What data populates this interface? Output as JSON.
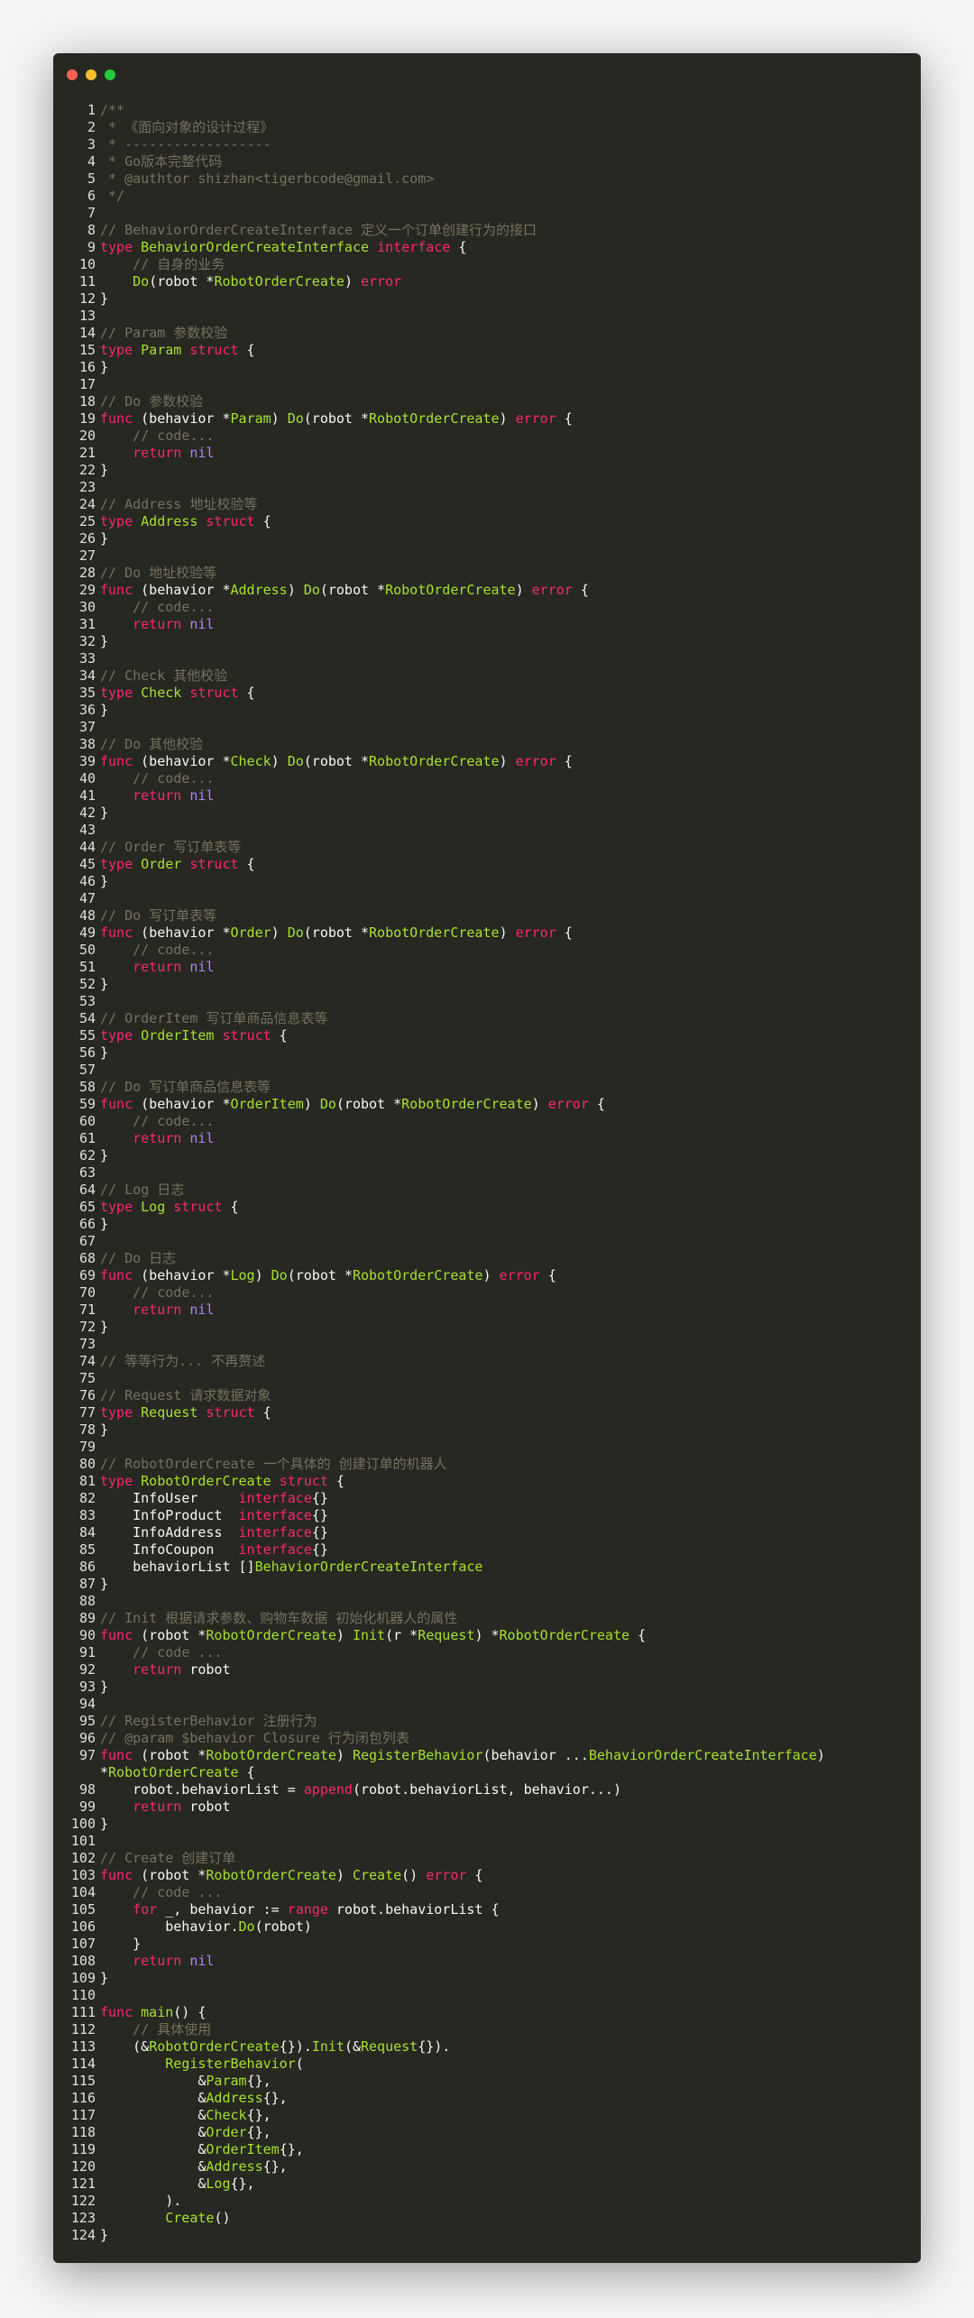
{
  "window": {
    "traffic_lights": [
      "close",
      "minimize",
      "maximize"
    ]
  },
  "lines": [
    [
      [
        "c",
        "/**"
      ]
    ],
    [
      [
        "c",
        " * 《面向对象的设计过程》"
      ]
    ],
    [
      [
        "c",
        " * ------------------"
      ]
    ],
    [
      [
        "c",
        " * Go版本完整代码"
      ]
    ],
    [
      [
        "c",
        " * @authtor shizhan<tigerbcode@gmail.com>"
      ]
    ],
    [
      [
        "c",
        " */"
      ]
    ],
    [],
    [
      [
        "c",
        "// BehaviorOrderCreateInterface 定义一个订单创建行为的接口"
      ]
    ],
    [
      [
        "k",
        "type"
      ],
      [
        "p",
        " "
      ],
      [
        "t",
        "BehaviorOrderCreateInterface"
      ],
      [
        "p",
        " "
      ],
      [
        "k",
        "interface"
      ],
      [
        "p",
        " {"
      ]
    ],
    [
      [
        "p",
        "    "
      ],
      [
        "c",
        "// 自身的业务"
      ]
    ],
    [
      [
        "p",
        "    "
      ],
      [
        "t",
        "Do"
      ],
      [
        "p",
        "(robot *"
      ],
      [
        "t",
        "RobotOrderCreate"
      ],
      [
        "p",
        ") "
      ],
      [
        "k",
        "error"
      ]
    ],
    [
      [
        "p",
        "}"
      ]
    ],
    [],
    [
      [
        "c",
        "// Param 参数校验"
      ]
    ],
    [
      [
        "k",
        "type"
      ],
      [
        "p",
        " "
      ],
      [
        "t",
        "Param"
      ],
      [
        "p",
        " "
      ],
      [
        "k",
        "struct"
      ],
      [
        "p",
        " {"
      ]
    ],
    [
      [
        "p",
        "}"
      ]
    ],
    [],
    [
      [
        "c",
        "// Do 参数校验"
      ]
    ],
    [
      [
        "k",
        "func"
      ],
      [
        "p",
        " (behavior *"
      ],
      [
        "t",
        "Param"
      ],
      [
        "p",
        ") "
      ],
      [
        "t",
        "Do"
      ],
      [
        "p",
        "(robot *"
      ],
      [
        "t",
        "RobotOrderCreate"
      ],
      [
        "p",
        ") "
      ],
      [
        "k",
        "error"
      ],
      [
        "p",
        " {"
      ]
    ],
    [
      [
        "p",
        "    "
      ],
      [
        "c",
        "// code..."
      ]
    ],
    [
      [
        "p",
        "    "
      ],
      [
        "k",
        "return"
      ],
      [
        "p",
        " "
      ],
      [
        "n",
        "nil"
      ]
    ],
    [
      [
        "p",
        "}"
      ]
    ],
    [],
    [
      [
        "c",
        "// Address 地址校验等"
      ]
    ],
    [
      [
        "k",
        "type"
      ],
      [
        "p",
        " "
      ],
      [
        "t",
        "Address"
      ],
      [
        "p",
        " "
      ],
      [
        "k",
        "struct"
      ],
      [
        "p",
        " {"
      ]
    ],
    [
      [
        "p",
        "}"
      ]
    ],
    [],
    [
      [
        "c",
        "// Do 地址校验等"
      ]
    ],
    [
      [
        "k",
        "func"
      ],
      [
        "p",
        " (behavior *"
      ],
      [
        "t",
        "Address"
      ],
      [
        "p",
        ") "
      ],
      [
        "t",
        "Do"
      ],
      [
        "p",
        "(robot *"
      ],
      [
        "t",
        "RobotOrderCreate"
      ],
      [
        "p",
        ") "
      ],
      [
        "k",
        "error"
      ],
      [
        "p",
        " {"
      ]
    ],
    [
      [
        "p",
        "    "
      ],
      [
        "c",
        "// code..."
      ]
    ],
    [
      [
        "p",
        "    "
      ],
      [
        "k",
        "return"
      ],
      [
        "p",
        " "
      ],
      [
        "n",
        "nil"
      ]
    ],
    [
      [
        "p",
        "}"
      ]
    ],
    [],
    [
      [
        "c",
        "// Check 其他校验"
      ]
    ],
    [
      [
        "k",
        "type"
      ],
      [
        "p",
        " "
      ],
      [
        "t",
        "Check"
      ],
      [
        "p",
        " "
      ],
      [
        "k",
        "struct"
      ],
      [
        "p",
        " {"
      ]
    ],
    [
      [
        "p",
        "}"
      ]
    ],
    [],
    [
      [
        "c",
        "// Do 其他校验"
      ]
    ],
    [
      [
        "k",
        "func"
      ],
      [
        "p",
        " (behavior *"
      ],
      [
        "t",
        "Check"
      ],
      [
        "p",
        ") "
      ],
      [
        "t",
        "Do"
      ],
      [
        "p",
        "(robot *"
      ],
      [
        "t",
        "RobotOrderCreate"
      ],
      [
        "p",
        ") "
      ],
      [
        "k",
        "error"
      ],
      [
        "p",
        " {"
      ]
    ],
    [
      [
        "p",
        "    "
      ],
      [
        "c",
        "// code..."
      ]
    ],
    [
      [
        "p",
        "    "
      ],
      [
        "k",
        "return"
      ],
      [
        "p",
        " "
      ],
      [
        "n",
        "nil"
      ]
    ],
    [
      [
        "p",
        "}"
      ]
    ],
    [],
    [
      [
        "c",
        "// Order 写订单表等"
      ]
    ],
    [
      [
        "k",
        "type"
      ],
      [
        "p",
        " "
      ],
      [
        "t",
        "Order"
      ],
      [
        "p",
        " "
      ],
      [
        "k",
        "struct"
      ],
      [
        "p",
        " {"
      ]
    ],
    [
      [
        "p",
        "}"
      ]
    ],
    [],
    [
      [
        "c",
        "// Do 写订单表等"
      ]
    ],
    [
      [
        "k",
        "func"
      ],
      [
        "p",
        " (behavior *"
      ],
      [
        "t",
        "Order"
      ],
      [
        "p",
        ") "
      ],
      [
        "t",
        "Do"
      ],
      [
        "p",
        "(robot *"
      ],
      [
        "t",
        "RobotOrderCreate"
      ],
      [
        "p",
        ") "
      ],
      [
        "k",
        "error"
      ],
      [
        "p",
        " {"
      ]
    ],
    [
      [
        "p",
        "    "
      ],
      [
        "c",
        "// code..."
      ]
    ],
    [
      [
        "p",
        "    "
      ],
      [
        "k",
        "return"
      ],
      [
        "p",
        " "
      ],
      [
        "n",
        "nil"
      ]
    ],
    [
      [
        "p",
        "}"
      ]
    ],
    [],
    [
      [
        "c",
        "// OrderItem 写订单商品信息表等"
      ]
    ],
    [
      [
        "k",
        "type"
      ],
      [
        "p",
        " "
      ],
      [
        "t",
        "OrderItem"
      ],
      [
        "p",
        " "
      ],
      [
        "k",
        "struct"
      ],
      [
        "p",
        " {"
      ]
    ],
    [
      [
        "p",
        "}"
      ]
    ],
    [],
    [
      [
        "c",
        "// Do 写订单商品信息表等"
      ]
    ],
    [
      [
        "k",
        "func"
      ],
      [
        "p",
        " (behavior *"
      ],
      [
        "t",
        "OrderItem"
      ],
      [
        "p",
        ") "
      ],
      [
        "t",
        "Do"
      ],
      [
        "p",
        "(robot *"
      ],
      [
        "t",
        "RobotOrderCreate"
      ],
      [
        "p",
        ") "
      ],
      [
        "k",
        "error"
      ],
      [
        "p",
        " {"
      ]
    ],
    [
      [
        "p",
        "    "
      ],
      [
        "c",
        "// code..."
      ]
    ],
    [
      [
        "p",
        "    "
      ],
      [
        "k",
        "return"
      ],
      [
        "p",
        " "
      ],
      [
        "n",
        "nil"
      ]
    ],
    [
      [
        "p",
        "}"
      ]
    ],
    [],
    [
      [
        "c",
        "// Log 日志"
      ]
    ],
    [
      [
        "k",
        "type"
      ],
      [
        "p",
        " "
      ],
      [
        "t",
        "Log"
      ],
      [
        "p",
        " "
      ],
      [
        "k",
        "struct"
      ],
      [
        "p",
        " {"
      ]
    ],
    [
      [
        "p",
        "}"
      ]
    ],
    [],
    [
      [
        "c",
        "// Do 日志"
      ]
    ],
    [
      [
        "k",
        "func"
      ],
      [
        "p",
        " (behavior *"
      ],
      [
        "t",
        "Log"
      ],
      [
        "p",
        ") "
      ],
      [
        "t",
        "Do"
      ],
      [
        "p",
        "(robot *"
      ],
      [
        "t",
        "RobotOrderCreate"
      ],
      [
        "p",
        ") "
      ],
      [
        "k",
        "error"
      ],
      [
        "p",
        " {"
      ]
    ],
    [
      [
        "p",
        "    "
      ],
      [
        "c",
        "// code..."
      ]
    ],
    [
      [
        "p",
        "    "
      ],
      [
        "k",
        "return"
      ],
      [
        "p",
        " "
      ],
      [
        "n",
        "nil"
      ]
    ],
    [
      [
        "p",
        "}"
      ]
    ],
    [],
    [
      [
        "c",
        "// 等等行为... 不再赘述"
      ]
    ],
    [],
    [
      [
        "c",
        "// Request 请求数据对象"
      ]
    ],
    [
      [
        "k",
        "type"
      ],
      [
        "p",
        " "
      ],
      [
        "t",
        "Request"
      ],
      [
        "p",
        " "
      ],
      [
        "k",
        "struct"
      ],
      [
        "p",
        " {"
      ]
    ],
    [
      [
        "p",
        "}"
      ]
    ],
    [],
    [
      [
        "c",
        "// RobotOrderCreate 一个具体的 创建订单的机器人"
      ]
    ],
    [
      [
        "k",
        "type"
      ],
      [
        "p",
        " "
      ],
      [
        "t",
        "RobotOrderCreate"
      ],
      [
        "p",
        " "
      ],
      [
        "k",
        "struct"
      ],
      [
        "p",
        " {"
      ]
    ],
    [
      [
        "p",
        "    InfoUser     "
      ],
      [
        "k",
        "interface"
      ],
      [
        "p",
        "{}"
      ]
    ],
    [
      [
        "p",
        "    InfoProduct  "
      ],
      [
        "k",
        "interface"
      ],
      [
        "p",
        "{}"
      ]
    ],
    [
      [
        "p",
        "    InfoAddress  "
      ],
      [
        "k",
        "interface"
      ],
      [
        "p",
        "{}"
      ]
    ],
    [
      [
        "p",
        "    InfoCoupon   "
      ],
      [
        "k",
        "interface"
      ],
      [
        "p",
        "{}"
      ]
    ],
    [
      [
        "p",
        "    behaviorList []"
      ],
      [
        "t",
        "BehaviorOrderCreateInterface"
      ]
    ],
    [
      [
        "p",
        "}"
      ]
    ],
    [],
    [
      [
        "c",
        "// Init 根据请求参数、购物车数据 初始化机器人的属性"
      ]
    ],
    [
      [
        "k",
        "func"
      ],
      [
        "p",
        " (robot *"
      ],
      [
        "t",
        "RobotOrderCreate"
      ],
      [
        "p",
        ") "
      ],
      [
        "t",
        "Init"
      ],
      [
        "p",
        "(r *"
      ],
      [
        "t",
        "Request"
      ],
      [
        "p",
        ") *"
      ],
      [
        "t",
        "RobotOrderCreate"
      ],
      [
        "p",
        " {"
      ]
    ],
    [
      [
        "p",
        "    "
      ],
      [
        "c",
        "// code ..."
      ]
    ],
    [
      [
        "p",
        "    "
      ],
      [
        "k",
        "return"
      ],
      [
        "p",
        " robot"
      ]
    ],
    [
      [
        "p",
        "}"
      ]
    ],
    [],
    [
      [
        "c",
        "// RegisterBehavior 注册行为"
      ]
    ],
    [
      [
        "c",
        "// @param $behavior Closure 行为闭包列表"
      ]
    ],
    [
      [
        "k",
        "func"
      ],
      [
        "p",
        " (robot *"
      ],
      [
        "t",
        "RobotOrderCreate"
      ],
      [
        "p",
        ") "
      ],
      [
        "t",
        "RegisterBehavior"
      ],
      [
        "p",
        "(behavior ..."
      ],
      [
        "t",
        "BehaviorOrderCreateInterface"
      ],
      [
        "p",
        ")"
      ]
    ],
    [
      [
        "p",
        "*"
      ],
      [
        "t",
        "RobotOrderCreate"
      ],
      [
        "p",
        " {"
      ]
    ],
    [
      [
        "p",
        "    robot.behaviorList = "
      ],
      [
        "k",
        "append"
      ],
      [
        "p",
        "(robot.behaviorList, behavior...)"
      ]
    ],
    [
      [
        "p",
        "    "
      ],
      [
        "k",
        "return"
      ],
      [
        "p",
        " robot"
      ]
    ],
    [
      [
        "p",
        "}"
      ]
    ],
    [],
    [
      [
        "c",
        "// Create 创建订单"
      ]
    ],
    [
      [
        "k",
        "func"
      ],
      [
        "p",
        " (robot *"
      ],
      [
        "t",
        "RobotOrderCreate"
      ],
      [
        "p",
        ") "
      ],
      [
        "t",
        "Create"
      ],
      [
        "p",
        "() "
      ],
      [
        "k",
        "error"
      ],
      [
        "p",
        " {"
      ]
    ],
    [
      [
        "p",
        "    "
      ],
      [
        "c",
        "// code ..."
      ]
    ],
    [
      [
        "p",
        "    "
      ],
      [
        "k",
        "for"
      ],
      [
        "p",
        " _, behavior := "
      ],
      [
        "k",
        "range"
      ],
      [
        "p",
        " robot.behaviorList {"
      ]
    ],
    [
      [
        "p",
        "        behavior."
      ],
      [
        "t",
        "Do"
      ],
      [
        "p",
        "(robot)"
      ]
    ],
    [
      [
        "p",
        "    }"
      ]
    ],
    [
      [
        "p",
        "    "
      ],
      [
        "k",
        "return"
      ],
      [
        "p",
        " "
      ],
      [
        "n",
        "nil"
      ]
    ],
    [
      [
        "p",
        "}"
      ]
    ],
    [],
    [
      [
        "k",
        "func"
      ],
      [
        "p",
        " "
      ],
      [
        "t",
        "main"
      ],
      [
        "p",
        "() {"
      ]
    ],
    [
      [
        "p",
        "    "
      ],
      [
        "c",
        "// 具体使用"
      ]
    ],
    [
      [
        "p",
        "    (&"
      ],
      [
        "t",
        "RobotOrderCreate"
      ],
      [
        "p",
        "{})."
      ],
      [
        "t",
        "Init"
      ],
      [
        "p",
        "(&"
      ],
      [
        "t",
        "Request"
      ],
      [
        "p",
        "{})."
      ]
    ],
    [
      [
        "p",
        "        "
      ],
      [
        "t",
        "RegisterBehavior"
      ],
      [
        "p",
        "("
      ]
    ],
    [
      [
        "p",
        "            &"
      ],
      [
        "t",
        "Param"
      ],
      [
        "p",
        "{},"
      ]
    ],
    [
      [
        "p",
        "            &"
      ],
      [
        "t",
        "Address"
      ],
      [
        "p",
        "{},"
      ]
    ],
    [
      [
        "p",
        "            &"
      ],
      [
        "t",
        "Check"
      ],
      [
        "p",
        "{},"
      ]
    ],
    [
      [
        "p",
        "            &"
      ],
      [
        "t",
        "Order"
      ],
      [
        "p",
        "{},"
      ]
    ],
    [
      [
        "p",
        "            &"
      ],
      [
        "t",
        "OrderItem"
      ],
      [
        "p",
        "{},"
      ]
    ],
    [
      [
        "p",
        "            &"
      ],
      [
        "t",
        "Address"
      ],
      [
        "p",
        "{},"
      ]
    ],
    [
      [
        "p",
        "            &"
      ],
      [
        "t",
        "Log"
      ],
      [
        "p",
        "{},"
      ]
    ],
    [
      [
        "p",
        "        )."
      ]
    ],
    [
      [
        "p",
        "        "
      ],
      [
        "t",
        "Create"
      ],
      [
        "p",
        "()"
      ]
    ],
    [
      [
        "p",
        "}"
      ]
    ]
  ],
  "line_numbers": [
    "1",
    "2",
    "3",
    "4",
    "5",
    "6",
    "7",
    "8",
    "9",
    "10",
    "11",
    "12",
    "13",
    "14",
    "15",
    "16",
    "17",
    "18",
    "19",
    "20",
    "21",
    "22",
    "23",
    "24",
    "25",
    "26",
    "27",
    "28",
    "29",
    "30",
    "31",
    "32",
    "33",
    "34",
    "35",
    "36",
    "37",
    "38",
    "39",
    "40",
    "41",
    "42",
    "43",
    "44",
    "45",
    "46",
    "47",
    "48",
    "49",
    "50",
    "51",
    "52",
    "53",
    "54",
    "55",
    "56",
    "57",
    "58",
    "59",
    "60",
    "61",
    "62",
    "63",
    "64",
    "65",
    "66",
    "67",
    "68",
    "69",
    "70",
    "71",
    "72",
    "73",
    "74",
    "75",
    "76",
    "77",
    "78",
    "79",
    "80",
    "81",
    "82",
    "83",
    "84",
    "85",
    "86",
    "87",
    "88",
    "89",
    "90",
    "91",
    "92",
    "93",
    "94",
    "95",
    "96",
    "97",
    "",
    "98",
    "99",
    "100",
    "101",
    "102",
    "103",
    "104",
    "105",
    "106",
    "107",
    "108",
    "109",
    "110",
    "111",
    "112",
    "113",
    "114",
    "115",
    "116",
    "117",
    "118",
    "119",
    "120",
    "121",
    "122",
    "123",
    "124"
  ]
}
